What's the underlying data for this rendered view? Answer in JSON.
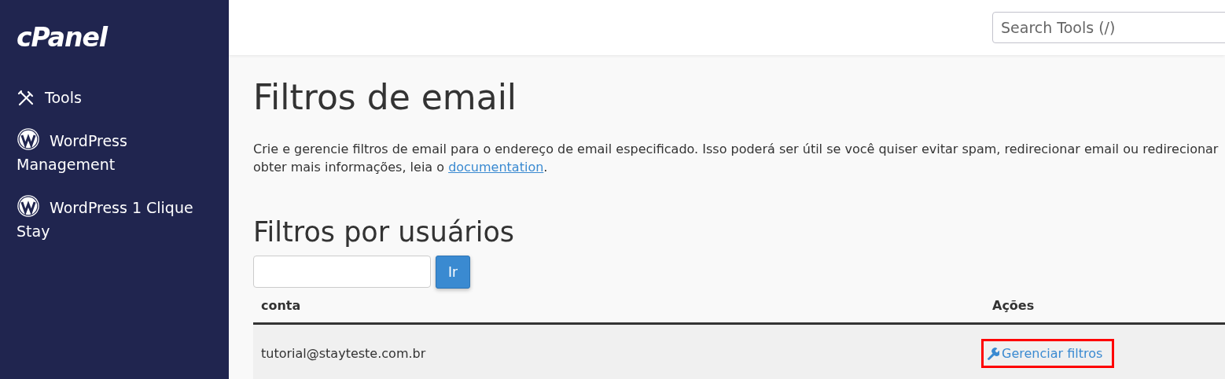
{
  "sidebar": {
    "logo": "cPanel",
    "items": [
      {
        "label": "Tools",
        "kind": "tools"
      },
      {
        "label": "WordPress Management",
        "kind": "wordpress"
      },
      {
        "label": "WordPress 1 Clique Stay",
        "kind": "wordpress"
      }
    ]
  },
  "header": {
    "search": {
      "placeholder": "Search Tools (/)"
    }
  },
  "page": {
    "title": "Filtros de email",
    "description": {
      "line_1": "Crie e gerencie filtros de email para o endereço de email especificado. Isso poderá ser útil se você quiser evitar spam, redirecionar email ou redirecionar",
      "line_2": "obter mais informações, leia o",
      "link": "documentation",
      "end": "."
    }
  },
  "section": {
    "heading": "Filtros por usuários",
    "filter_button": "Ir"
  },
  "table": {
    "columns": [
      "conta",
      "Ações"
    ],
    "rows": [
      {
        "account": "tutorial@stayteste.com.br",
        "action": {
          "label": "Gerenciar filtros",
          "highlighted": true
        }
      }
    ]
  }
}
